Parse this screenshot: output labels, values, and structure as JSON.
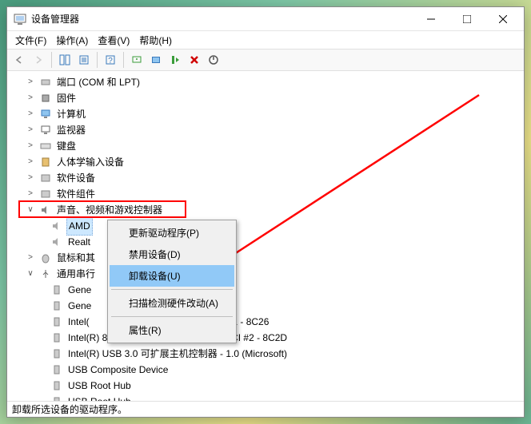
{
  "window": {
    "title": "设备管理器"
  },
  "menubar": {
    "file": "文件(F)",
    "action": "操作(A)",
    "view": "查看(V)",
    "help": "帮助(H)"
  },
  "tree": {
    "ports": "端口 (COM 和 LPT)",
    "firmware": "固件",
    "computer": "计算机",
    "monitor": "监视器",
    "keyboard": "键盘",
    "hid": "人体学输入设备",
    "software_devices": "软件设备",
    "software_components": "软件组件",
    "sound": "声音、视频和游戏控制器",
    "sound_child1": "AMD",
    "sound_child2": "Realt",
    "mouse": "鼠标和其",
    "usb": "通用串行",
    "usb1": "Gene",
    "usb2": "Gene",
    "usb3": "Intel(",
    "usb3_suffix": "#1 - 8C26",
    "usb4": "Intel(R) 8 Series/C220 Series USB EHCI #2 - 8C2D",
    "usb5": "Intel(R) USB 3.0 可扩展主机控制器 - 1.0 (Microsoft)",
    "usb6": "USB Composite Device",
    "usb7": "USB Root Hub",
    "usb8": "USB Root Hub"
  },
  "context_menu": {
    "update": "更新驱动程序(P)",
    "disable": "禁用设备(D)",
    "uninstall": "卸载设备(U)",
    "scan": "扫描检测硬件改动(A)",
    "properties": "属性(R)"
  },
  "statusbar": {
    "text": "卸载所选设备的驱动程序。"
  }
}
